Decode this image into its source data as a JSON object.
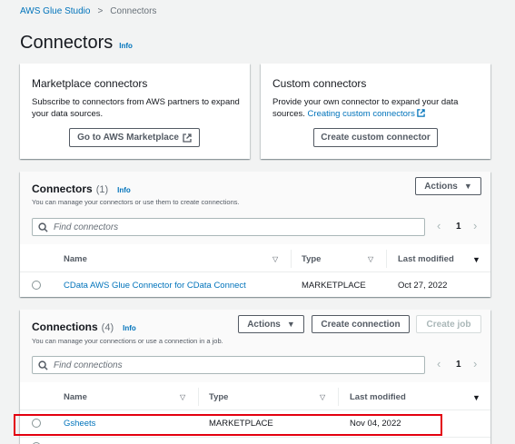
{
  "breadcrumb": {
    "root": "AWS Glue Studio",
    "separator": ">",
    "current": "Connectors"
  },
  "page": {
    "title": "Connectors",
    "info": "Info"
  },
  "marketplace": {
    "title": "Marketplace connectors",
    "description": "Subscribe to connectors from AWS partners to expand your data sources.",
    "button": "Go to AWS Marketplace"
  },
  "custom": {
    "title": "Custom connectors",
    "description_prefix": "Provide your own connector to expand your data sources.",
    "link": "Creating custom connectors",
    "button": "Create custom connector"
  },
  "connectors": {
    "title": "Connectors",
    "count": "(1)",
    "info": "Info",
    "description": "You can manage your connectors or use them to create connections.",
    "actions_button": "Actions",
    "search_placeholder": "Find connectors",
    "page": "1",
    "columns": [
      "Name",
      "Type",
      "Last modified"
    ],
    "rows": [
      {
        "name": "CData AWS Glue Connector for CData Connect",
        "type": "MARKETPLACE",
        "modified": "Oct 27, 2022"
      }
    ]
  },
  "connections": {
    "title": "Connections",
    "count": "(4)",
    "info": "Info",
    "description": "You can manage your connections or use a connection in a job.",
    "actions_button": "Actions",
    "create_button": "Create connection",
    "job_button": "Create job",
    "search_placeholder": "Find connections",
    "page": "1",
    "columns": [
      "Name",
      "Type",
      "Last modified"
    ],
    "rows": [
      {
        "name": "Gsheets",
        "type": "MARKETPLACE",
        "modified": "Nov 04, 2022"
      }
    ]
  },
  "colors": {
    "link": "#0073bb",
    "highlight": "#e3000f",
    "background": "#f2f3f3"
  }
}
